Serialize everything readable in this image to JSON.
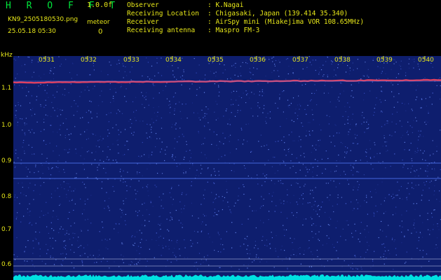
{
  "header": {
    "app_title": "H R O F F T",
    "version": "1.0.0f",
    "filename": "KN9_2505180530.png",
    "meteor_label": "meteor",
    "meteor_count": "0",
    "datetime": "25.05.18 05:30"
  },
  "info": [
    {
      "label": "Observer",
      "value": ": K.Nagai"
    },
    {
      "label": "Receiving Location",
      "value": ": Chigasaki, Japan (139.414 35.340)"
    },
    {
      "label": "Receiver",
      "value": ": AirSpy mini (Miakejima VOR 108.65MHz)"
    },
    {
      "label": "Receiving antenna",
      "value": ": Maspro FM-3"
    }
  ],
  "axis": {
    "unit": "kHz",
    "y_ticks": [
      "1.1",
      "1.0",
      "0.9",
      "0.8",
      "0.7",
      "0.6"
    ],
    "x_ticks": [
      "0531",
      "0532",
      "0533",
      "0534",
      "0535",
      "0536",
      "0537",
      "0538",
      "0539",
      "0540"
    ]
  },
  "colors": {
    "background": "#0e1e6e",
    "text": "#e6e619",
    "title": "#00e63c",
    "carrier": "#e04060",
    "noise_floor": "#00e0e0"
  }
}
